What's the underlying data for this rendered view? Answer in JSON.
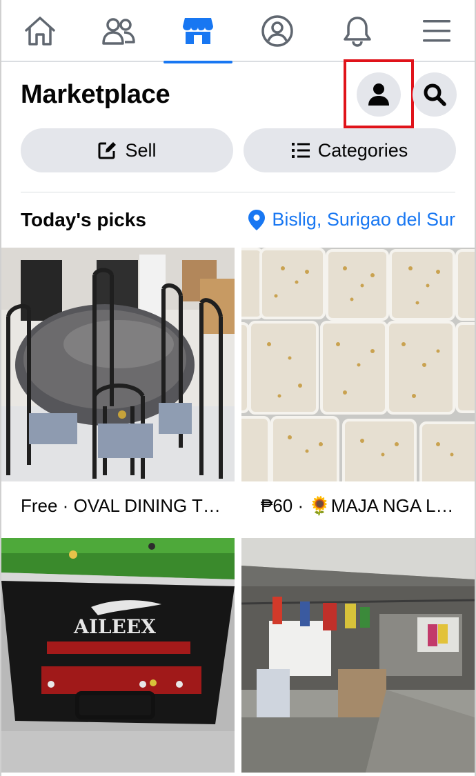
{
  "nav": {
    "items": [
      {
        "icon": "home-icon"
      },
      {
        "icon": "friends-icon"
      },
      {
        "icon": "marketplace-icon",
        "active": true
      },
      {
        "icon": "profile-icon"
      },
      {
        "icon": "bell-icon"
      },
      {
        "icon": "menu-icon"
      }
    ]
  },
  "header": {
    "title": "Marketplace"
  },
  "actions": {
    "sell_label": "Sell",
    "categories_label": "Categories"
  },
  "picks": {
    "title": "Today's picks",
    "location": "Bislig, Surigao del Sur"
  },
  "listings": [
    {
      "caption": "Free · OVAL DINING T…",
      "image": "dining-table-photo"
    },
    {
      "caption": "₱60 · 🌻MAJA NGA L…",
      "image": "maja-dessert-photo"
    },
    {
      "caption": "",
      "image": "billiard-table-photo"
    },
    {
      "caption": "",
      "image": "yard-shed-photo"
    }
  ],
  "colors": {
    "accent": "#1877f2",
    "button_bg": "#e4e6eb",
    "highlight": "#e0131a"
  }
}
